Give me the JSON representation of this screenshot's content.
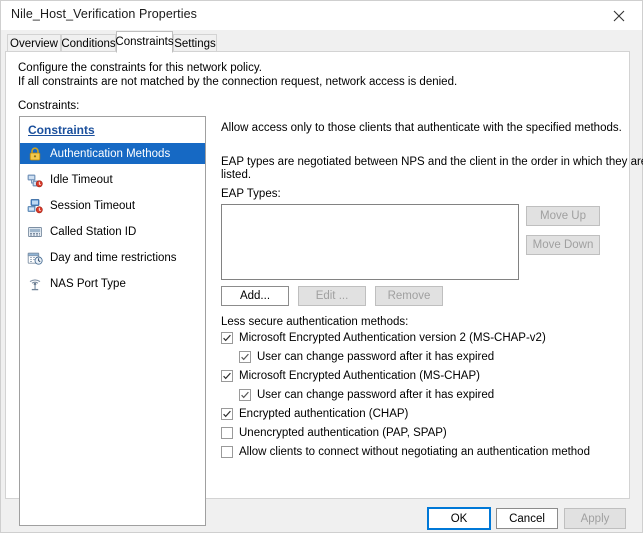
{
  "window": {
    "title": "Nile_Host_Verification Properties",
    "close_icon": "close-icon"
  },
  "tabs": [
    {
      "label": "Overview",
      "active": false
    },
    {
      "label": "Conditions",
      "active": false
    },
    {
      "label": "Constraints",
      "active": true
    },
    {
      "label": "Settings",
      "active": false
    }
  ],
  "description": {
    "line1": "Configure the constraints for this network policy.",
    "line2": "If all constraints are not matched by the connection request, network access is denied.",
    "constraints_label": "Constraints:"
  },
  "constraints_list": {
    "header": "Constraints",
    "items": [
      {
        "label": "Authentication Methods",
        "icon": "padlock-icon",
        "selected": true
      },
      {
        "label": "Idle Timeout",
        "icon": "network-timer-icon",
        "selected": false
      },
      {
        "label": "Session Timeout",
        "icon": "session-timer-icon",
        "selected": false
      },
      {
        "label": "Called Station ID",
        "icon": "station-id-icon",
        "selected": false
      },
      {
        "label": "Day and time restrictions",
        "icon": "calendar-clock-icon",
        "selected": false
      },
      {
        "label": "NAS Port Type",
        "icon": "antenna-icon",
        "selected": false
      }
    ]
  },
  "right_pane": {
    "intro": "Allow access only to those clients that authenticate with the specified methods.",
    "eap_note_line1": "EAP types are negotiated between NPS and the client in the order in which they are",
    "eap_note_line2": "listed.",
    "eap_types_label": "EAP Types:",
    "eap_types_items": [],
    "buttons": {
      "move_up": {
        "label": "Move Up",
        "enabled": false
      },
      "move_down": {
        "label": "Move Down",
        "enabled": false
      },
      "add": {
        "label": "Add...",
        "enabled": true
      },
      "edit": {
        "label": "Edit ...",
        "enabled": false
      },
      "remove": {
        "label": "Remove",
        "enabled": false
      }
    },
    "less_secure_label": "Less secure authentication methods:",
    "checkboxes": [
      {
        "label": "Microsoft Encrypted Authentication version 2 (MS-CHAP-v2)",
        "checked": true,
        "indent": 0
      },
      {
        "label": "User can change password after it has expired",
        "checked": true,
        "indent": 1
      },
      {
        "label": "Microsoft Encrypted Authentication (MS-CHAP)",
        "checked": true,
        "indent": 0
      },
      {
        "label": "User can change password after it has expired",
        "checked": true,
        "indent": 1
      },
      {
        "label": "Encrypted authentication (CHAP)",
        "checked": true,
        "indent": 0
      },
      {
        "label": "Unencrypted authentication (PAP, SPAP)",
        "checked": false,
        "indent": 0
      },
      {
        "label": "Allow clients to connect without negotiating an authentication method",
        "checked": false,
        "indent": 0
      }
    ]
  },
  "footer": {
    "ok": {
      "label": "OK",
      "enabled": true,
      "default": true
    },
    "cancel": {
      "label": "Cancel",
      "enabled": true,
      "default": false
    },
    "apply": {
      "label": "Apply",
      "enabled": false,
      "default": false
    }
  },
  "colors": {
    "selection_blue": "#1669c4",
    "header_link_blue": "#1a4f9c",
    "focus_blue": "#0078d7",
    "dialog_bg": "#f0f0f0",
    "panel_bg": "#ffffff"
  }
}
